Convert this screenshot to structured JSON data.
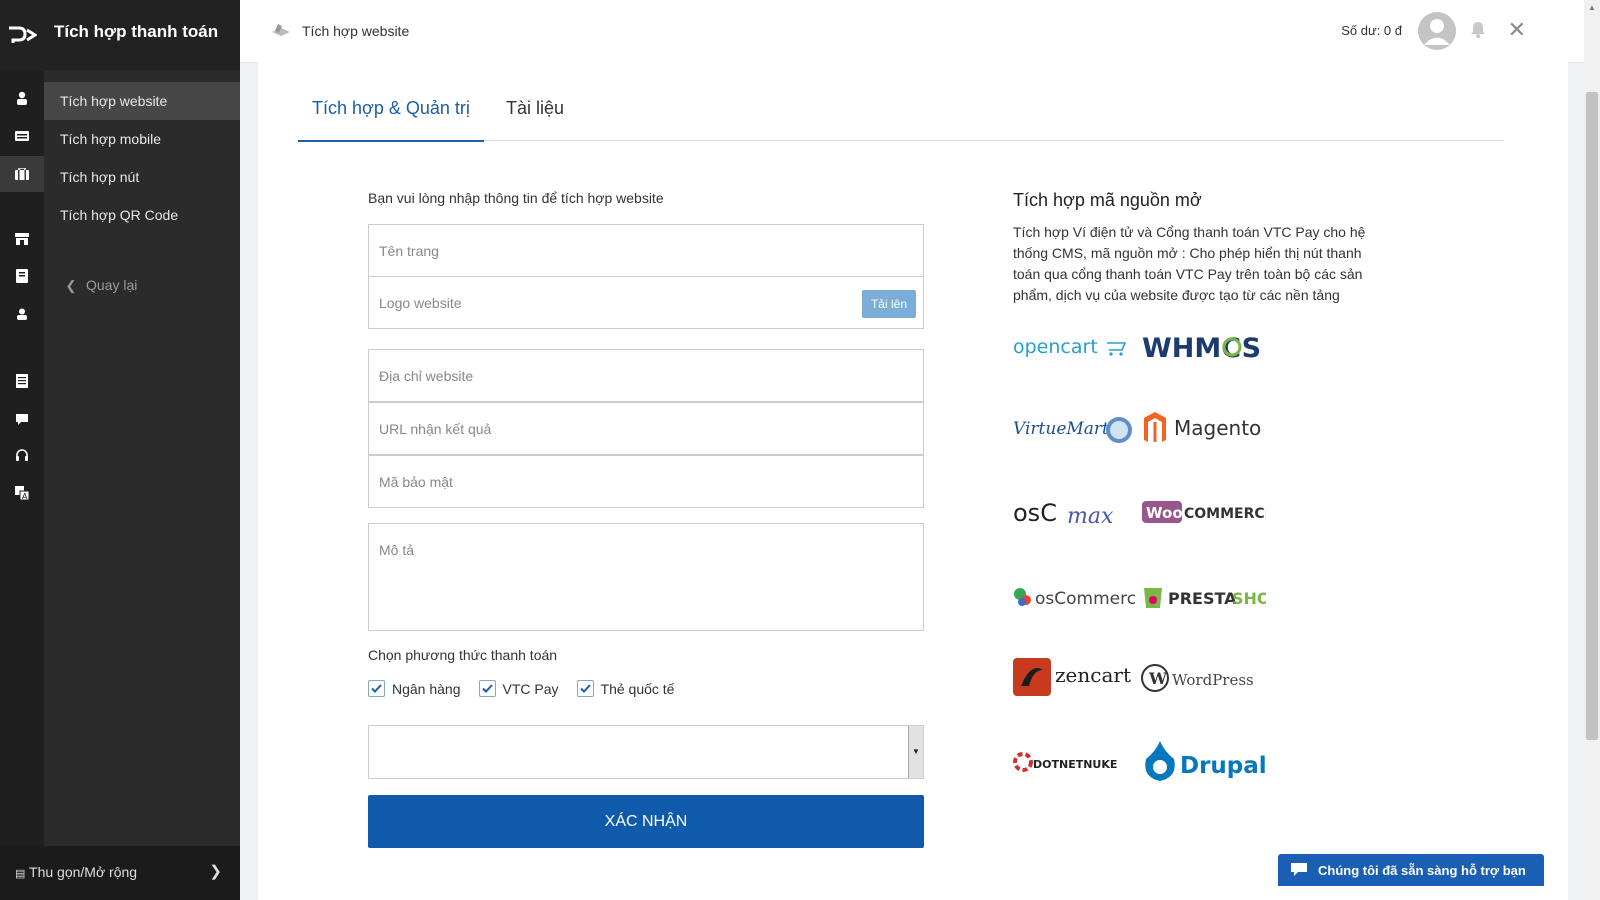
{
  "app": {
    "title": "Tích hợp thanh toán"
  },
  "sidebar": {
    "items": [
      {
        "label": "Tích hợp website",
        "active": true
      },
      {
        "label": "Tích hợp mobile",
        "active": false
      },
      {
        "label": "Tích hợp nút",
        "active": false
      },
      {
        "label": "Tích hợp QR Code",
        "active": false
      }
    ],
    "back_label": "Quay lại",
    "collapse_label": "Thu gọn/Mở rộng"
  },
  "topbar": {
    "breadcrumb": "Tích hợp website",
    "balance": "Số dư: 0 đ"
  },
  "tabs": [
    {
      "label": "Tích hợp & Quản trị",
      "active": true
    },
    {
      "label": "Tài liệu",
      "active": false
    }
  ],
  "form": {
    "intro": "Bạn vui lòng nhập thông tin để tích hợp  website",
    "fields": {
      "page_name": "Tên trang",
      "logo": "Logo website",
      "website_url": "Địa chỉ website",
      "result_url": "URL nhận kết quả",
      "secret": "Mã bảo mật",
      "description": "Mô tả"
    },
    "upload_label": "Tải lên",
    "payment_label": "Chọn phương thức thanh toán",
    "methods": [
      {
        "label": "Ngân hàng",
        "checked": true
      },
      {
        "label": "VTC Pay",
        "checked": true
      },
      {
        "label": "Thẻ quốc tế",
        "checked": true
      }
    ],
    "select_value": "",
    "submit_label": "XÁC NHẬN"
  },
  "oss": {
    "title": "Tích hợp mã nguồn mở",
    "description": "Tích hợp Ví điện tử và Cổng thanh toán VTC Pay cho hệ thống CMS, mã nguồn mở : Cho phép hiển thị nút thanh toán qua cổng thanh toán VTC Pay  trên toàn bộ các sản phẩm, dịch vụ của website được tạo từ các nền tảng",
    "logos": [
      "opencart",
      "WHMCS",
      "VirtueMart",
      "Magento",
      "osCmax",
      "WooCommerce",
      "osCommerce",
      "PrestaShop",
      "zencart",
      "WordPress",
      "DotNetNuke",
      "Drupal"
    ]
  },
  "chat": {
    "label": "Chúng tôi đã sẵn sàng hỗ trợ bạn"
  },
  "colors": {
    "accent": "#1a5fa8",
    "button": "#0f5aaa",
    "sidebar": "#2b2b2b",
    "rail": "#1f1f1f"
  }
}
